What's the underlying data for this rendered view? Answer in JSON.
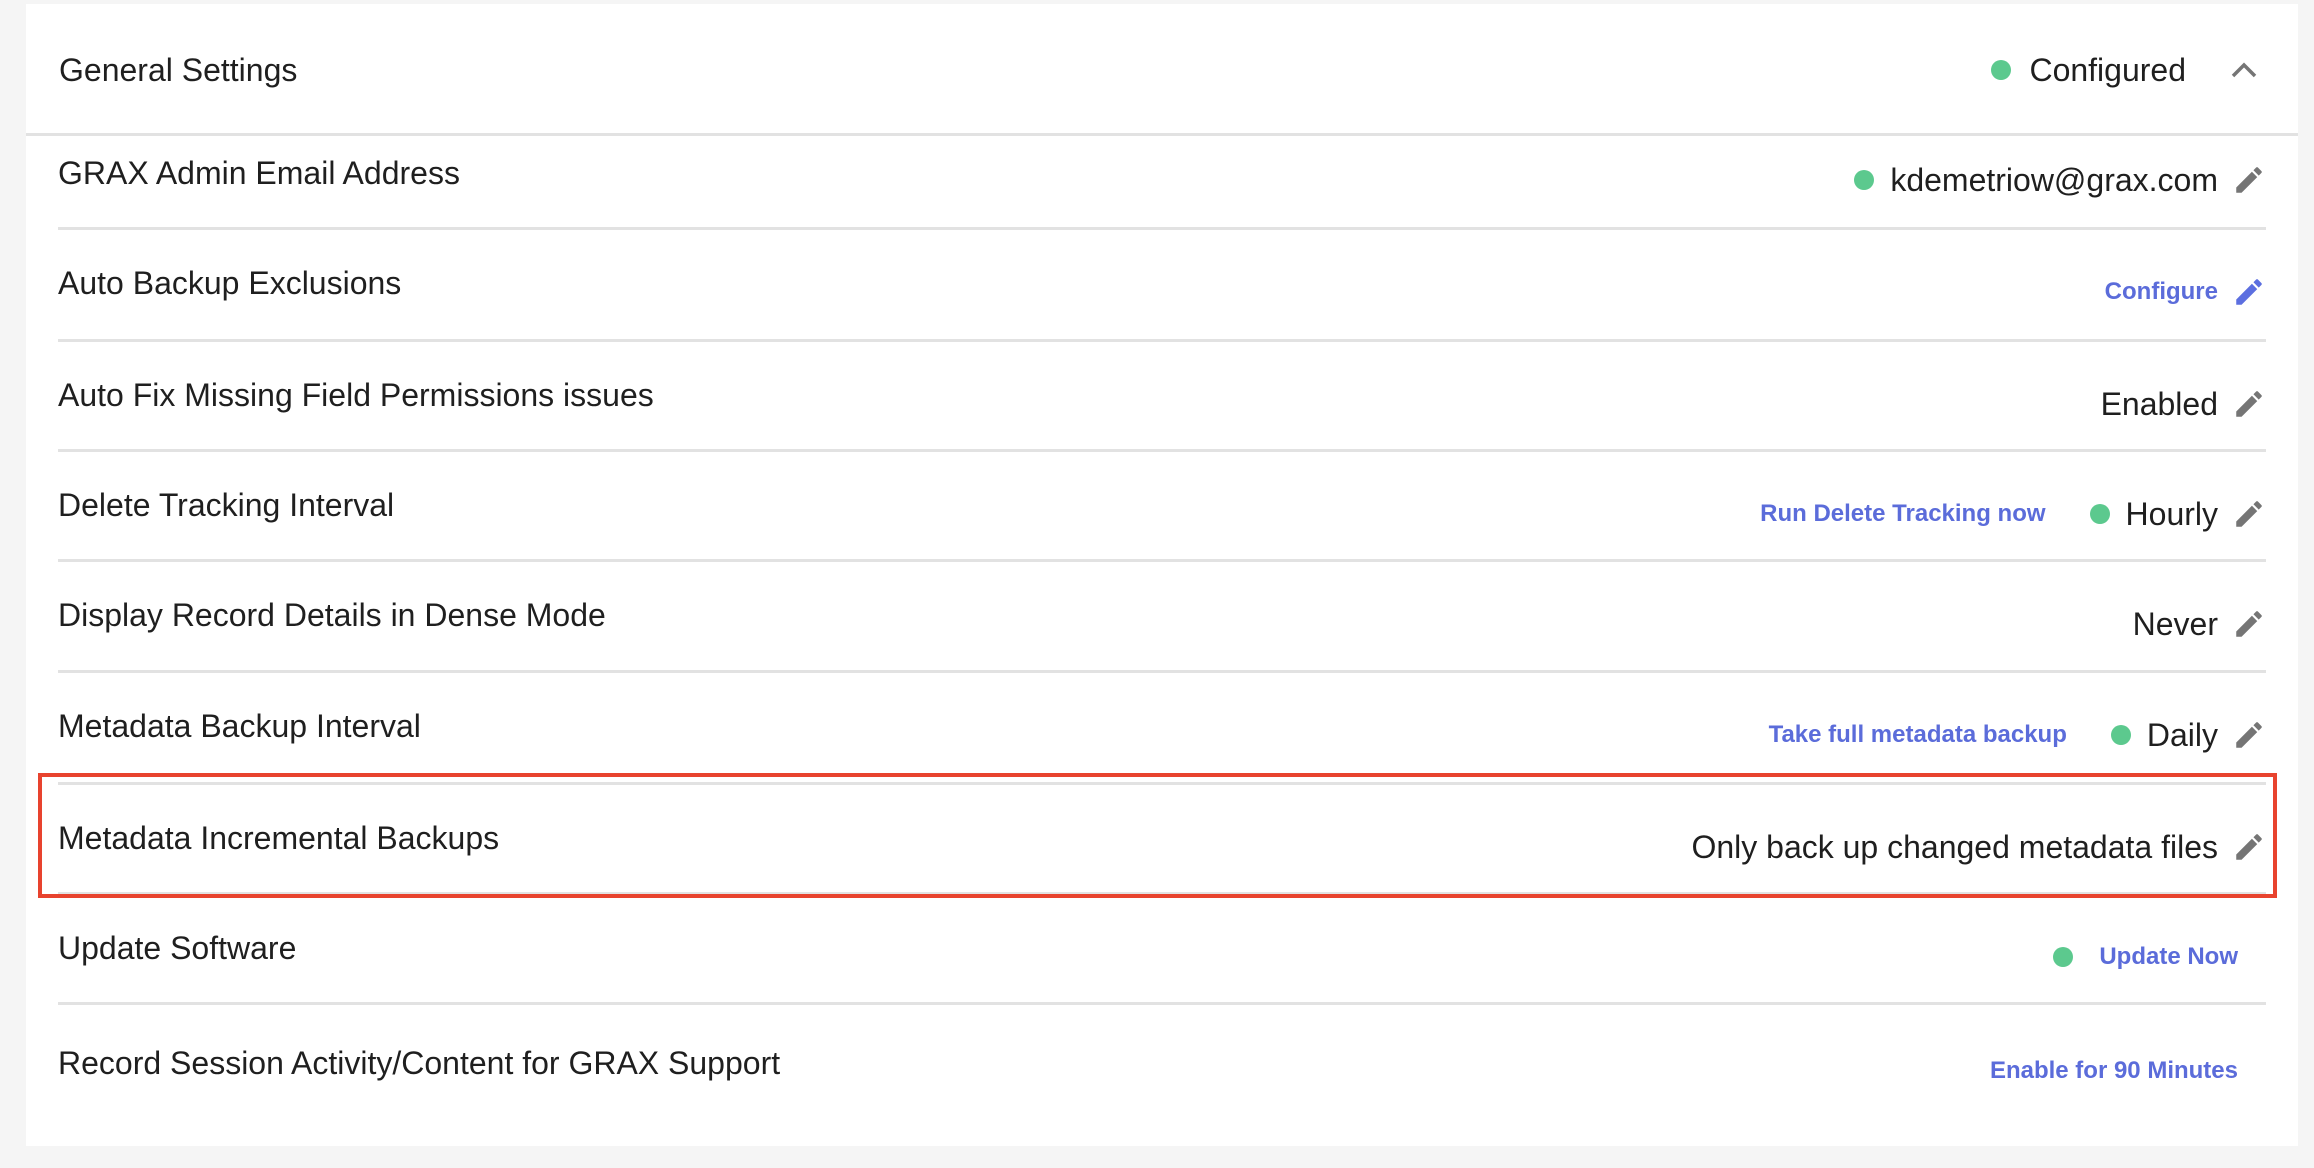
{
  "colors": {
    "status_green": "#5cc98e",
    "link_blue": "#5b6cda",
    "icon_gray": "#757575",
    "highlight_red": "#e8432e"
  },
  "header": {
    "title": "General Settings",
    "status_icon": "status-dot",
    "status": "Configured",
    "collapse_icon": "chevron-up-icon"
  },
  "settings": [
    {
      "label": "GRAX Admin Email Address",
      "status_dot": true,
      "value": "kdemetriow@grax.com",
      "edit_icon": "pencil-icon"
    },
    {
      "label": "Auto Backup Exclusions",
      "link": "Configure",
      "edit_icon": "pencil-icon",
      "edit_icon_color": "blue"
    },
    {
      "label": "Auto Fix Missing Field Permissions issues",
      "value": "Enabled",
      "edit_icon": "pencil-icon"
    },
    {
      "label": "Delete Tracking Interval",
      "action_link": "Run Delete Tracking now",
      "status_dot": true,
      "value": "Hourly",
      "edit_icon": "pencil-icon"
    },
    {
      "label": "Display Record Details in Dense Mode",
      "value": "Never",
      "edit_icon": "pencil-icon"
    },
    {
      "label": "Metadata Backup Interval",
      "action_link": "Take full metadata backup",
      "status_dot": true,
      "value": "Daily",
      "edit_icon": "pencil-icon"
    },
    {
      "label": "Metadata Incremental Backups",
      "value": "Only back up changed metadata files",
      "edit_icon": "pencil-icon",
      "highlighted": true
    },
    {
      "label": "Update Software",
      "status_dot": true,
      "action_link": "Update Now"
    },
    {
      "label": "Record Session Activity/Content for GRAX Support",
      "action_link": "Enable for 90 Minutes"
    }
  ]
}
